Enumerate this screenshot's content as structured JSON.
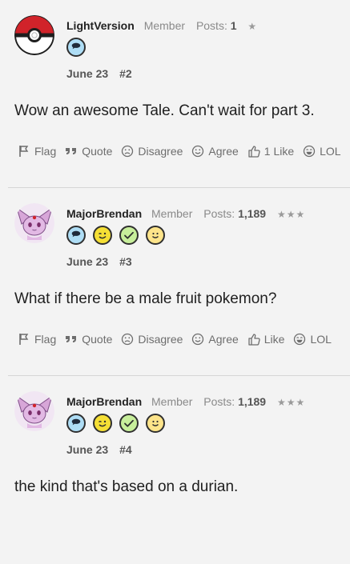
{
  "posts": [
    {
      "avatar_icon": "pokeball-avatar",
      "username": "LightVersion",
      "role": "Member",
      "posts_label": "Posts:",
      "posts_count": "1",
      "stars": "★",
      "badges": [
        "chat-bubble-icon"
      ],
      "date": "June 23",
      "number": "#2",
      "message": "Wow an awesome Tale. Can't wait for part 3.",
      "actions": {
        "flag": "Flag",
        "quote": "Quote",
        "disagree": "Disagree",
        "agree": "Agree",
        "like": "1 Like",
        "lol": "LOL"
      }
    },
    {
      "avatar_icon": "espeon-avatar",
      "username": "MajorBrendan",
      "role": "Member",
      "posts_label": "Posts:",
      "posts_count": "1,189",
      "stars": "★★★",
      "badges": [
        "chat-bubble-icon",
        "wink-face-icon",
        "checkmark-icon",
        "smile-face-icon"
      ],
      "date": "June 23",
      "number": "#3",
      "message": "What if there be a male fruit pokemon?",
      "actions": {
        "flag": "Flag",
        "quote": "Quote",
        "disagree": "Disagree",
        "agree": "Agree",
        "like": "Like",
        "lol": "LOL"
      }
    },
    {
      "avatar_icon": "espeon-avatar",
      "username": "MajorBrendan",
      "role": "Member",
      "posts_label": "Posts:",
      "posts_count": "1,189",
      "stars": "★★★",
      "badges": [
        "chat-bubble-icon",
        "wink-face-icon",
        "checkmark-icon",
        "smile-face-icon"
      ],
      "date": "June 23",
      "number": "#4",
      "message": "the kind that's based on a durian."
    }
  ],
  "colors": {
    "background": "#f3f3f3",
    "separator": "#d6d6d6",
    "badge_blue": "#aeddf5",
    "badge_yellow": "#f5df35",
    "badge_green": "#c7ee9b"
  }
}
